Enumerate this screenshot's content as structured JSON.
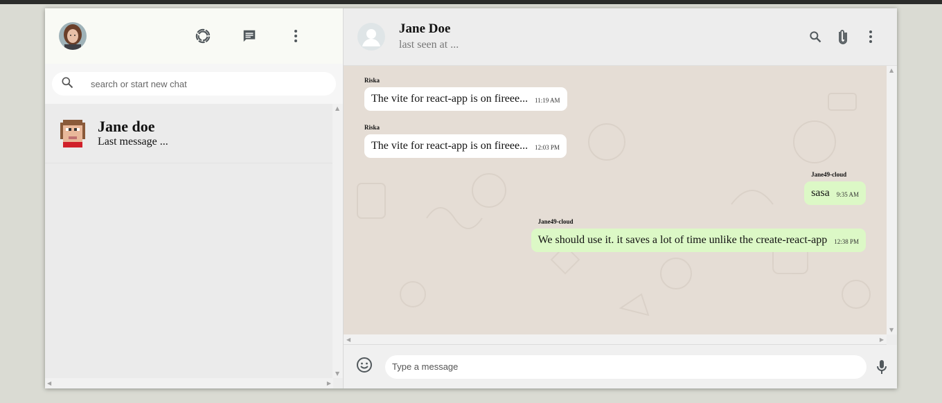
{
  "sidebar": {
    "header": {
      "icons": [
        "user-avatar",
        "status-icon",
        "new-chat-icon",
        "more-vert-icon"
      ]
    },
    "search": {
      "placeholder": "search or start new chat"
    },
    "chats": [
      {
        "name": "Jane doe",
        "last_message": "Last message ..."
      }
    ]
  },
  "chat": {
    "header": {
      "name": "Jane Doe",
      "status": "last seen at ...",
      "icons": [
        "search-icon",
        "attach-icon",
        "more-vert-icon"
      ]
    },
    "messages": [
      {
        "sender": "Riska",
        "text": "The vite for react-app is on fireee...",
        "time": "11:19 AM",
        "direction": "in"
      },
      {
        "sender": "Riska",
        "text": "The vite for react-app is on fireee...",
        "time": "12:03 PM",
        "direction": "in"
      },
      {
        "sender": "Jane49-cloud",
        "text": "sasa",
        "time": "9:35 AM",
        "direction": "out"
      },
      {
        "sender": "Jane49-cloud",
        "text": "We should use it. it saves a lot of time unlike the create-react-app",
        "time": "12:38 PM",
        "direction": "out"
      }
    ],
    "composer": {
      "placeholder": "Type a message",
      "icons": [
        "emoji-icon",
        "mic-icon"
      ]
    }
  },
  "colors": {
    "outgoing_bubble": "#dcf8c6",
    "incoming_bubble": "#ffffff",
    "chat_background": "#e5ddd5",
    "icon": "#51585c"
  }
}
